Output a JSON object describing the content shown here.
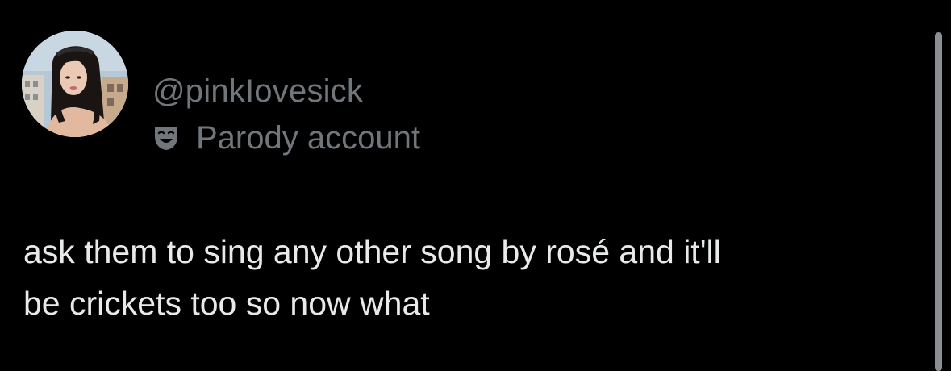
{
  "author": {
    "handle": "@pinkIovesick",
    "badge": {
      "icon": "parody-mask-icon",
      "label": "Parody account"
    },
    "avatar": "profile-photo"
  },
  "tweet": {
    "text": "ask them to sing any other song by rosé and it'll\nbe crickets too so now what"
  },
  "colors": {
    "background": "#000000",
    "text": "#e7e9ea",
    "secondary": "#71767b"
  }
}
